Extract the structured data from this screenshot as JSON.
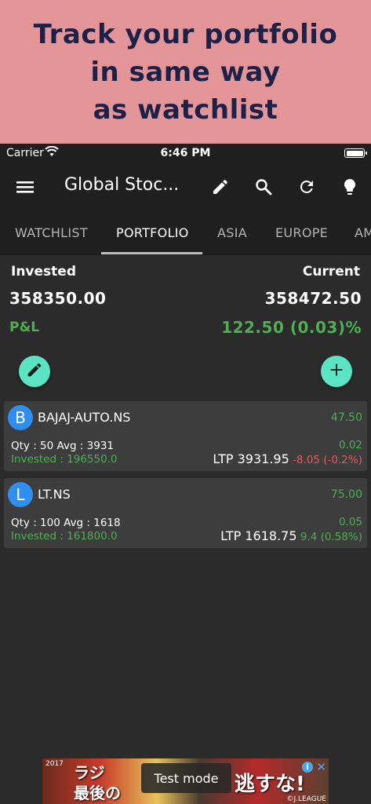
{
  "banner": {
    "lines": [
      "Track your portfolio",
      "in same way",
      "as watchlist"
    ],
    "background": "#e39598",
    "text_color": "#1e2147"
  },
  "status_bar": {
    "carrier": "Carrier",
    "time": "6:46 PM"
  },
  "toolbar": {
    "title": "Global Stoc...",
    "icons": [
      "menu-icon",
      "edit-icon",
      "search-icon",
      "refresh-icon",
      "lightbulb-icon"
    ]
  },
  "tabs": [
    {
      "label": "WATCHLIST",
      "active": false
    },
    {
      "label": "PORTFOLIO",
      "active": true
    },
    {
      "label": "ASIA",
      "active": false
    },
    {
      "label": "EUROPE",
      "active": false
    },
    {
      "label": "AM",
      "active": false
    }
  ],
  "summary": {
    "invested_label": "Invested",
    "invested_value": "358350.00",
    "current_label": "Current",
    "current_value": "358472.50",
    "pl_label": "P&L",
    "pl_value": "122.50 (0.03)%"
  },
  "holdings": [
    {
      "initial": "B",
      "symbol": "BAJAJ-AUTO.NS",
      "total_pl": "47.50",
      "qty_avg": "Qty : 50 Avg : 3931",
      "invested": "Invested : 196550.0",
      "day_pl": "0.02",
      "ltp": "LTP 3931.95",
      "change": "-8.05 (-0.2%)",
      "change_direction": "down"
    },
    {
      "initial": "L",
      "symbol": "LT.NS",
      "total_pl": "75.00",
      "qty_avg": "Qty : 100 Avg : 1618",
      "invested": "Invested : 161800.0",
      "day_pl": "0.05",
      "ltp": "LTP 1618.75",
      "change": "9.4 (0.58%)",
      "change_direction": "up"
    }
  ],
  "ad": {
    "test_label": "Test mode",
    "credit": "©J.LEAGUE",
    "text_left": "ラジ",
    "text_left2": "最後の",
    "text_right": "逃すな!",
    "badge": "2017"
  },
  "colors": {
    "background": "#2b2b2b",
    "toolbar": "#1f1f1f",
    "card": "#3d3d3d",
    "positive": "#4caf50",
    "negative": "#e85a5a",
    "fab": "#5be4c4",
    "avatar": "#2f8ef0"
  }
}
